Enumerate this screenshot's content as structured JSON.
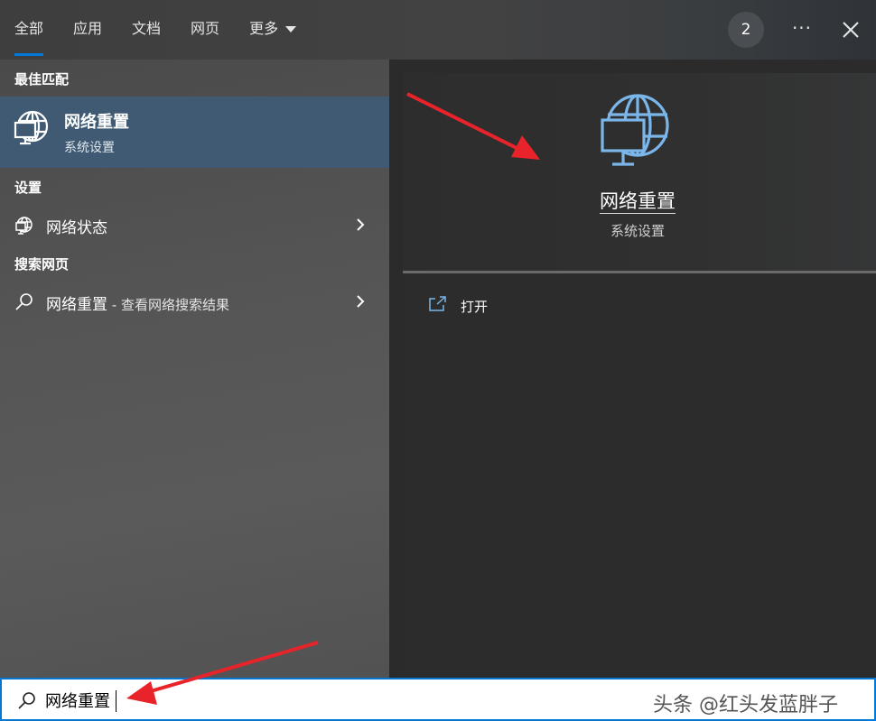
{
  "tabs": [
    {
      "label": "全部",
      "active": true
    },
    {
      "label": "应用"
    },
    {
      "label": "文档"
    },
    {
      "label": "网页"
    },
    {
      "label": "更多",
      "has_dropdown": true
    }
  ],
  "header": {
    "badge_count": "2",
    "more_label": "···",
    "close_icon": "close-icon"
  },
  "left": {
    "best_match_header": "最佳匹配",
    "best_match": {
      "title": "网络重置",
      "subtitle": "系统设置",
      "icon": "globe-monitor-icon"
    },
    "settings_header": "设置",
    "settings_item": {
      "label": "网络状态",
      "icon": "globe-icon"
    },
    "web_header": "搜索网页",
    "web_item": {
      "label": "网络重置",
      "hint": " - 查看网络搜索结果",
      "icon": "search-icon"
    }
  },
  "right": {
    "title": "网络重置",
    "subtitle": "系统设置",
    "open_label": "打开"
  },
  "search": {
    "value": "网络重置"
  },
  "watermark": "头条 @红头发蓝胖子",
  "colors": {
    "accent": "#0078d7",
    "icon_blue": "#7bb6ea",
    "annotation_red": "#e8242a",
    "selected_bg": "#3f5a72"
  }
}
